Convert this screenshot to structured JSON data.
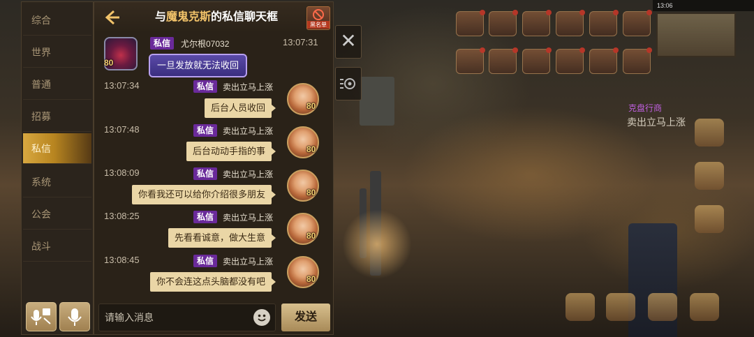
{
  "window": {
    "title_prefix": "与",
    "title_name": "魔鬼克斯",
    "title_suffix": "的私信聊天框",
    "blacklist_label": "黑名单"
  },
  "sidebar": {
    "items": [
      {
        "label": "综合",
        "active": false
      },
      {
        "label": "世界",
        "active": false
      },
      {
        "label": "普通",
        "active": false
      },
      {
        "label": "招募",
        "active": false
      },
      {
        "label": "私信",
        "active": true
      },
      {
        "label": "系统",
        "active": false
      },
      {
        "label": "公会",
        "active": false
      },
      {
        "label": "战斗",
        "active": false
      }
    ]
  },
  "messages": [
    {
      "side": "left",
      "tag": "私信",
      "sender": "尤尔根07032",
      "time": "13:07:31",
      "level": "80",
      "text": "一旦发放就无法收回",
      "avatar": "demon-avatar"
    },
    {
      "side": "right",
      "tag": "私信",
      "sender": "卖出立马上涨",
      "time": "13:07:34",
      "level": "80",
      "text": "后台人员收回",
      "avatar": "girl-avatar"
    },
    {
      "side": "right",
      "tag": "私信",
      "sender": "卖出立马上涨",
      "time": "13:07:48",
      "level": "80",
      "text": "后台动动手指的事",
      "avatar": "girl-avatar"
    },
    {
      "side": "right",
      "tag": "私信",
      "sender": "卖出立马上涨",
      "time": "13:08:09",
      "level": "80",
      "text": "你看我还可以给你介绍很多朋友",
      "avatar": "girl-avatar"
    },
    {
      "side": "right",
      "tag": "私信",
      "sender": "卖出立马上涨",
      "time": "13:08:25",
      "level": "80",
      "text": "先看看诚意，做大生意",
      "avatar": "girl-avatar"
    },
    {
      "side": "right",
      "tag": "私信",
      "sender": "卖出立马上涨",
      "time": "13:08:45",
      "level": "80",
      "text": "你不会连这点头脑都没有吧",
      "avatar": "girl-avatar"
    }
  ],
  "input": {
    "placeholder": "请输入消息",
    "send_label": "发送"
  },
  "background": {
    "status_time": "13:06",
    "player_name": "卖出立马上涨",
    "player_title": "克盘行商"
  },
  "colors": {
    "accent_gold": "#d8a840",
    "tag_purple": "#6a2a9a",
    "bubble_beige": "#ead6a6",
    "title_highlight": "#f2c36a"
  }
}
